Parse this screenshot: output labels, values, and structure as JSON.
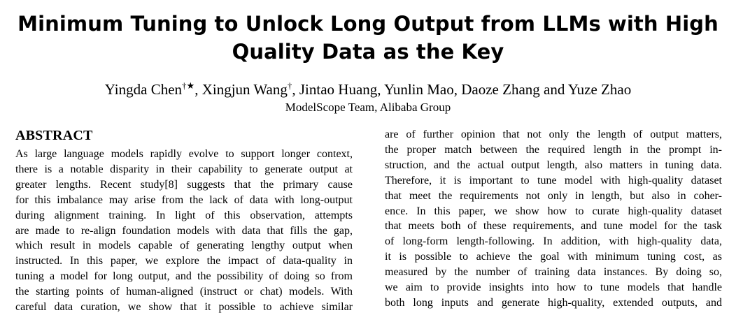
{
  "paper": {
    "title_line1": "Minimum Tuning to Unlock Long Output from LLMs with High",
    "title_line2": "Quality Data as the Key",
    "authors": {
      "a1": "Yingda Chen",
      "a1_marks": "†★",
      "sep1": ", ",
      "a2": "Xingjun Wang",
      "a2_marks": "†",
      "rest": ", Jintao Huang, Yunlin Mao, Daoze Zhang and Yuze Zhao"
    },
    "affiliation": "ModelScope Team, Alibaba Group",
    "abstract_heading": "ABSTRACT",
    "abstract_left_lines": [
      "As large language models rapidly evolve to support longer context,",
      "there is a notable disparity in their capability to generate output at",
      "greater lengths. Recent study[8] suggests that the primary cause",
      "for this imbalance may arise from the lack of data with long-output",
      "during alignment training. In light of this observation, attempts",
      "are made to re-align foundation models with data that fills the gap,",
      "which result in models capable of generating lengthy output when",
      "instructed. In this paper, we explore the impact of data-quality in",
      "tuning a model for long output, and the possibility of doing so from",
      "the starting points of human-aligned (instruct or chat) models. With",
      "careful data curation, we show that it possible to achieve similar"
    ],
    "abstract_right_lines": [
      "are of further opinion that not only the length of output matters,",
      "the proper match between the required length in the prompt in-",
      "struction, and the actual output length, also matters in tuning data.",
      "Therefore, it is important to tune model with high-quality dataset",
      "that meet the requirements not only in length, but also in coher-",
      "ence. In this paper, we show how to curate high-quality dataset",
      "that meets both of these requirements, and tune model for the task",
      "of long-form length-following. In addition, with high-quality data,",
      "it is possible to achieve the goal with minimum tuning cost, as",
      "measured by the number of training data instances. By doing so,",
      "we aim to provide insights into how to tune models that handle",
      "both long inputs and generate high-quality, extended outputs, and"
    ]
  }
}
